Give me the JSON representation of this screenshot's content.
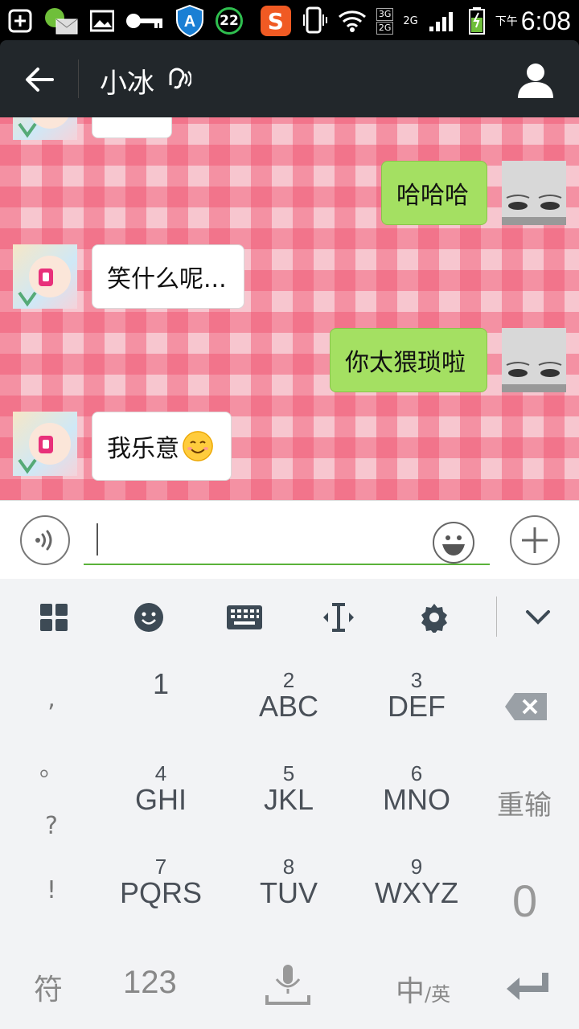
{
  "status_bar": {
    "badge": "22",
    "sogou": "S",
    "net_3g": "3G",
    "net_2g": "2G",
    "net_label": "2G",
    "ampm": "下午",
    "time": "6:08"
  },
  "header": {
    "title": "小冰"
  },
  "chat": {
    "messages": [
      {
        "side": "in",
        "text": ""
      },
      {
        "side": "out",
        "text": "哈哈哈"
      },
      {
        "side": "in",
        "text": "笑什么呢..."
      },
      {
        "side": "out",
        "text": "你太猥琐啦"
      },
      {
        "side": "in",
        "text": "我乐意"
      }
    ]
  },
  "input": {
    "value": ""
  },
  "keyboard": {
    "toolbar_icons": [
      "grid-icon",
      "emoji-icon",
      "keyboard-icon",
      "cursor-icon",
      "gear-icon",
      "chevron-down-icon"
    ],
    "side_symbols": [
      ",",
      "。",
      "?",
      "!"
    ],
    "keys": [
      {
        "num": "",
        "letters": "1"
      },
      {
        "num": "2",
        "letters": "ABC"
      },
      {
        "num": "3",
        "letters": "DEF"
      },
      {
        "num": "4",
        "letters": "GHI"
      },
      {
        "num": "5",
        "letters": "JKL"
      },
      {
        "num": "6",
        "letters": "MNO"
      },
      {
        "num": "7",
        "letters": "PQRS"
      },
      {
        "num": "8",
        "letters": "TUV"
      },
      {
        "num": "9",
        "letters": "WXYZ"
      }
    ],
    "reinput": "重输",
    "zero": "0",
    "symbols": "符",
    "numeric": "123",
    "lang_cn": "中",
    "lang_en": "/英"
  },
  "colors": {
    "header_bg": "#22272b",
    "bubble_out": "#a4e062",
    "bubble_in": "#ffffff",
    "input_underline": "#5ab23a"
  }
}
